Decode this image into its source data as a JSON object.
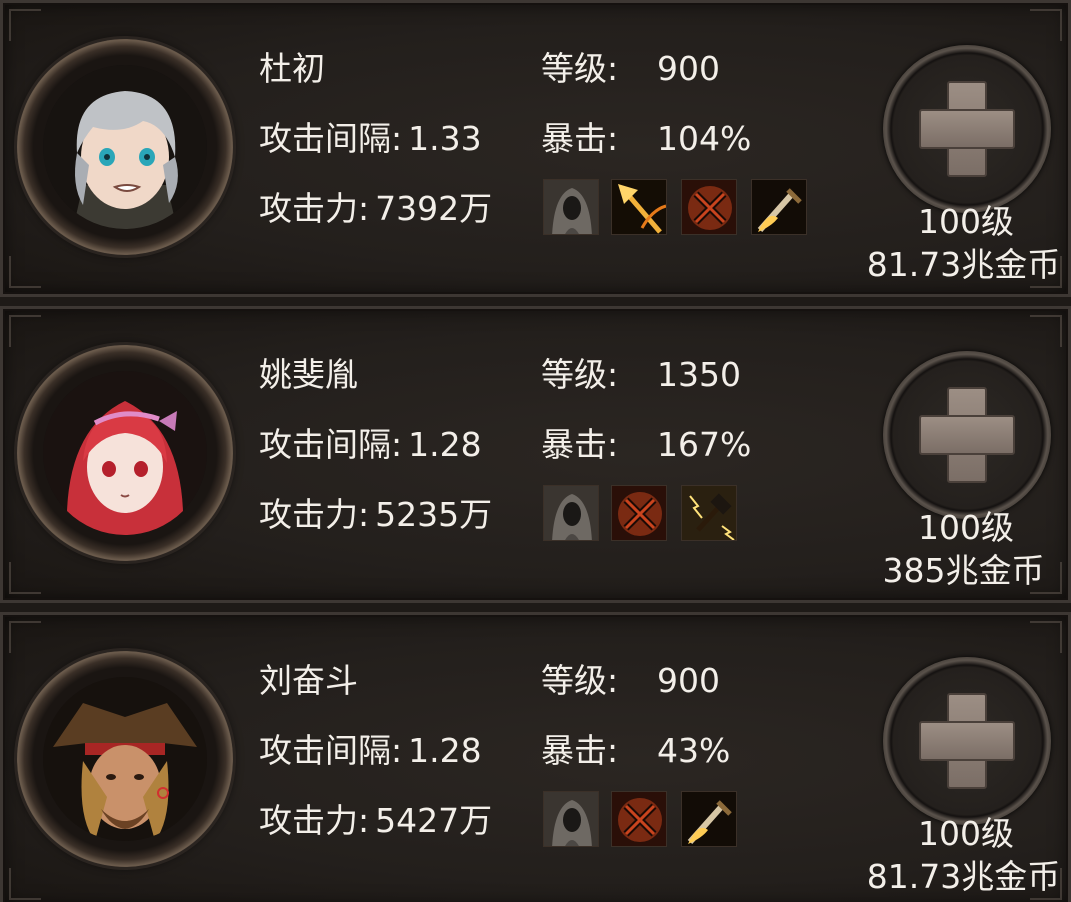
{
  "heroes": [
    {
      "name": "杜初",
      "level_label": "等级:",
      "level": "900",
      "interval_label": "攻击间隔:",
      "interval": "1.33",
      "crit_label": "暴击:",
      "crit": "104%",
      "attack_label": "攻击力:",
      "attack": "7392万",
      "skills": [
        "hooded-figure-icon",
        "arrow-strike-icon",
        "crossed-swords-icon",
        "flaming-sword-icon"
      ],
      "upgrade_level": "100级",
      "upgrade_cost": "81.73兆金币"
    },
    {
      "name": "姚斐胤",
      "level_label": "等级:",
      "level": "1350",
      "interval_label": "攻击间隔:",
      "interval": "1.28",
      "crit_label": "暴击:",
      "crit": "167%",
      "attack_label": "攻击力:",
      "attack": "5235万",
      "skills": [
        "hooded-figure-icon",
        "crossed-swords-icon",
        "lightning-hammer-icon"
      ],
      "upgrade_level": "100级",
      "upgrade_cost": "385兆金币"
    },
    {
      "name": "刘奋斗",
      "level_label": "等级:",
      "level": "900",
      "interval_label": "攻击间隔:",
      "interval": "1.28",
      "crit_label": "暴击:",
      "crit": "43%",
      "attack_label": "攻击力:",
      "attack": "5427万",
      "skills": [
        "hooded-figure-icon",
        "crossed-swords-icon",
        "flaming-sword-icon"
      ],
      "upgrade_level": "100级",
      "upgrade_cost": "81.73兆金币"
    }
  ],
  "colors": {
    "text": "#f3efe9",
    "panel": "#231f1c",
    "plus": "#8f8179"
  }
}
